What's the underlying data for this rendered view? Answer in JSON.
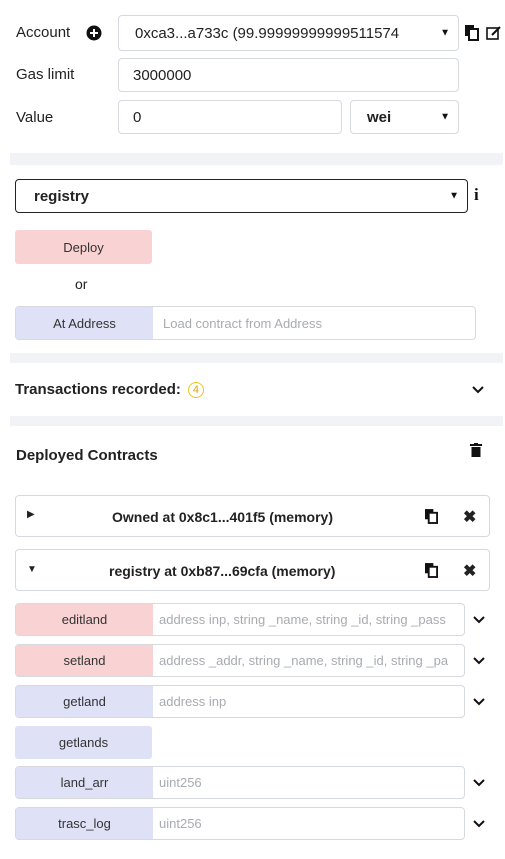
{
  "account": {
    "label": "Account",
    "value": "0xca3...a733c (99.99999999999511574",
    "plus_icon": "plus-circle-icon",
    "copy_icon": "copy-icon",
    "edit_icon": "edit-icon"
  },
  "gas_limit": {
    "label": "Gas limit",
    "value": "3000000"
  },
  "value": {
    "label": "Value",
    "amount": "0",
    "unit": "wei"
  },
  "contract_select": {
    "value": "registry",
    "info_icon": "info-icon"
  },
  "deploy": {
    "deploy_label": "Deploy",
    "or_label": "or",
    "at_address_label": "At Address",
    "address_placeholder": "Load contract from Address"
  },
  "transactions": {
    "label": "Transactions recorded:",
    "count": "4"
  },
  "deployed": {
    "title": "Deployed Contracts",
    "instances": [
      {
        "label": "Owned at 0x8c1...401f5 (memory)",
        "expanded": false
      },
      {
        "label": "registry at 0xb87...69cfa (memory)",
        "expanded": true
      }
    ],
    "functions": [
      {
        "name": "editland",
        "placeholder": "address inp, string _name, string _id, string _pass",
        "kind": "transact",
        "has_input": true
      },
      {
        "name": "setland",
        "placeholder": "address _addr, string _name, string _id, string _pa",
        "kind": "transact",
        "has_input": true
      },
      {
        "name": "getland",
        "placeholder": "address inp",
        "kind": "call",
        "has_input": true
      },
      {
        "name": "getlands",
        "placeholder": "",
        "kind": "call",
        "has_input": false
      },
      {
        "name": "land_arr",
        "placeholder": "uint256",
        "kind": "call",
        "has_input": true
      },
      {
        "name": "trasc_log",
        "placeholder": "uint256",
        "kind": "call",
        "has_input": true
      }
    ]
  },
  "colors": {
    "transact": "#f9d3d3",
    "call": "#dfe2f7",
    "badge": "#f0c419",
    "separator": "#f1f3f7"
  }
}
